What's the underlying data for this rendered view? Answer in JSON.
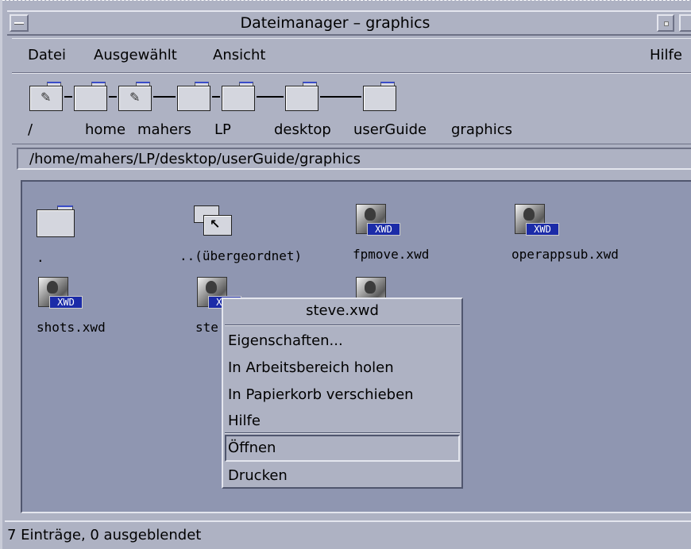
{
  "window": {
    "title": "Dateimanager – graphics"
  },
  "menubar": {
    "items": [
      {
        "label": "Datei"
      },
      {
        "label": "Ausgewählt"
      },
      {
        "label": "Ansicht"
      },
      {
        "label": "Hilfe"
      }
    ]
  },
  "iconpath": {
    "labels": [
      "/",
      "home",
      "mahers",
      "LP",
      "desktop",
      "userGuide",
      "graphics"
    ]
  },
  "path": {
    "value": "/home/mahers/LP/desktop/userGuide/graphics"
  },
  "files": [
    {
      "name": ".",
      "icon": "folder-icon"
    },
    {
      "name": "..(übergeordnet)",
      "icon": "parent-folder-icon"
    },
    {
      "name": "fpmove.xwd",
      "icon": "xwd-image-icon",
      "badge": "XWD"
    },
    {
      "name": "operappsub.xwd",
      "icon": "xwd-image-icon",
      "badge": "XWD"
    },
    {
      "name": "shots.xwd",
      "icon": "xwd-image-icon",
      "badge": "XWD"
    },
    {
      "name": "ste",
      "icon": "xwd-image-icon",
      "badge": "XWD"
    },
    {
      "name": "",
      "icon": "xwd-image-icon",
      "badge": ""
    }
  ],
  "context_menu": {
    "title": "steve.xwd",
    "items": [
      {
        "label": "Eigenschaften..."
      },
      {
        "label": "In Arbeitsbereich holen"
      },
      {
        "label": "In Papierkorb verschieben"
      },
      {
        "label": "Hilfe"
      },
      {
        "label": "Öffnen",
        "selected": true
      },
      {
        "label": "Drucken"
      }
    ]
  },
  "status": {
    "text": "7 Einträge, 0 ausgeblendet"
  },
  "colors": {
    "window_bg": "#aeb2c3",
    "view_bg": "#8f96b1",
    "xwd_badge": "#1b2ba8"
  }
}
